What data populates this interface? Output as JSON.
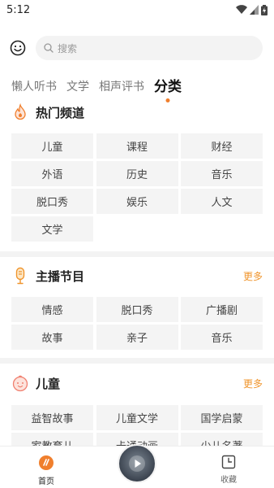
{
  "status_bar": {
    "time": "5:12"
  },
  "search": {
    "placeholder": "搜索"
  },
  "tabs": [
    {
      "label": "懒人听书",
      "active": false
    },
    {
      "label": "文学",
      "active": false
    },
    {
      "label": "相声评书",
      "active": false
    },
    {
      "label": "分类",
      "active": true
    }
  ],
  "sections": {
    "hot": {
      "title": "热门频道",
      "items": [
        "儿童",
        "课程",
        "财经",
        "外语",
        "历史",
        "音乐",
        "脱口秀",
        "娱乐",
        "人文",
        "文学"
      ]
    },
    "host": {
      "title": "主播节目",
      "more": "更多",
      "items": [
        "情感",
        "脱口秀",
        "广播剧",
        "故事",
        "亲子",
        "音乐"
      ]
    },
    "kids": {
      "title": "儿童",
      "more": "更多",
      "items": [
        "益智故事",
        "儿童文学",
        "国学启蒙",
        "家教育儿",
        "卡通动画",
        "少儿名著"
      ]
    }
  },
  "bottom_nav": {
    "home": "首页",
    "favorites": "收藏"
  },
  "colors": {
    "accent": "#f07f2d",
    "more": "#f0952d",
    "tile": "#f4f4f4"
  }
}
